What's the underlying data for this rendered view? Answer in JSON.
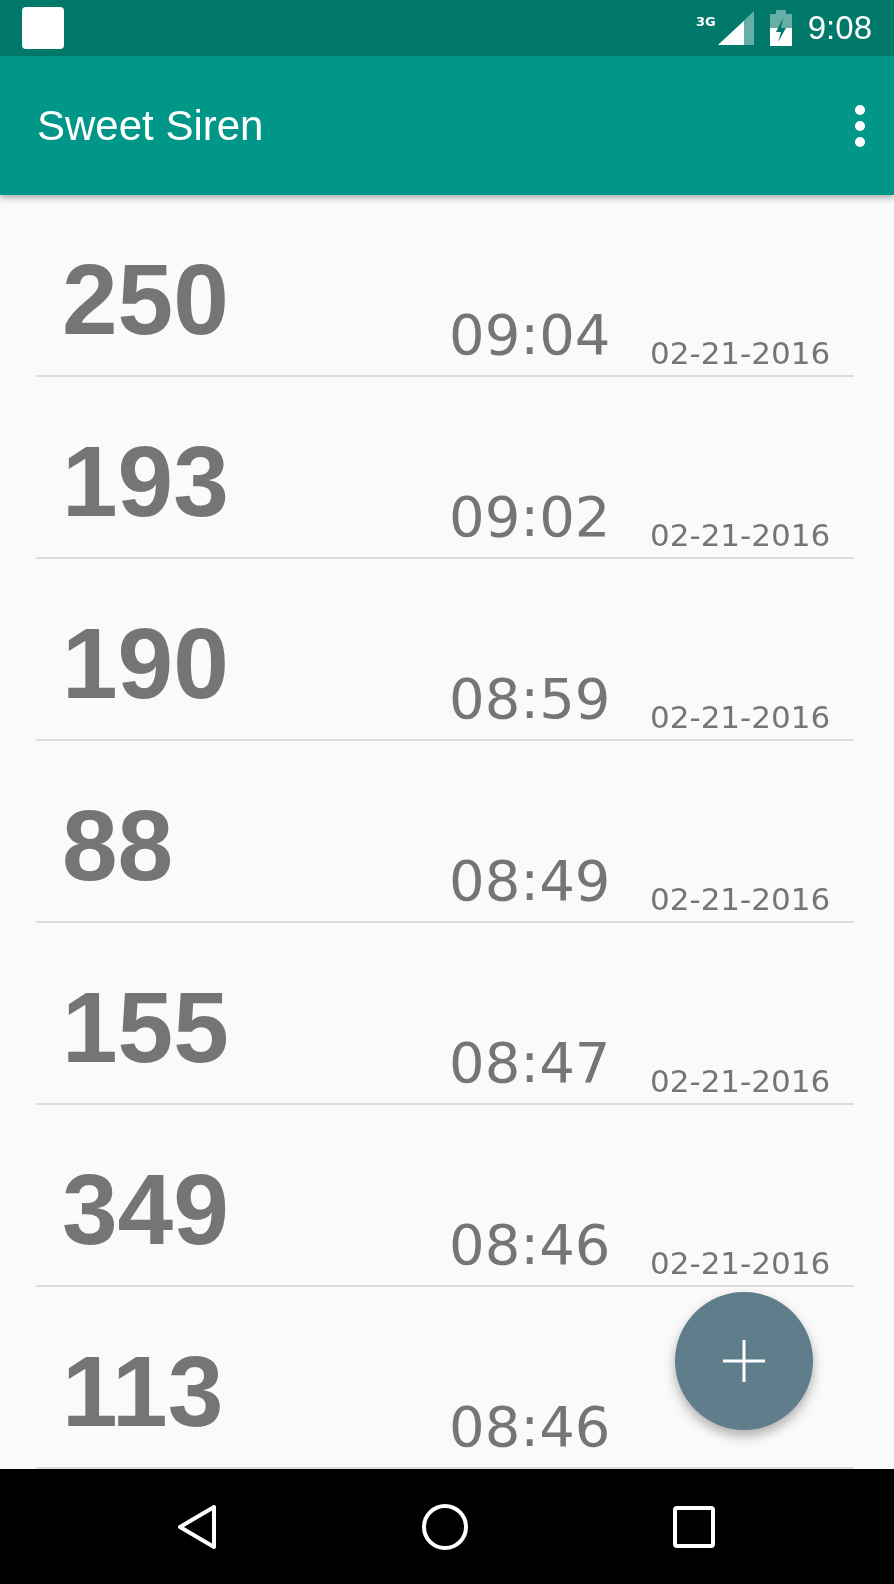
{
  "status_bar": {
    "network": "3G",
    "time": "9:08"
  },
  "app_bar": {
    "title": "Sweet Siren"
  },
  "readings": [
    {
      "value": "250",
      "time": "09:04",
      "date": "02-21-2016"
    },
    {
      "value": "193",
      "time": "09:02",
      "date": "02-21-2016"
    },
    {
      "value": "190",
      "time": "08:59",
      "date": "02-21-2016"
    },
    {
      "value": "88",
      "time": "08:49",
      "date": "02-21-2016"
    },
    {
      "value": "155",
      "time": "08:47",
      "date": "02-21-2016"
    },
    {
      "value": "349",
      "time": "08:46",
      "date": "02-21-2016"
    },
    {
      "value": "113",
      "time": "08:46"
    }
  ]
}
